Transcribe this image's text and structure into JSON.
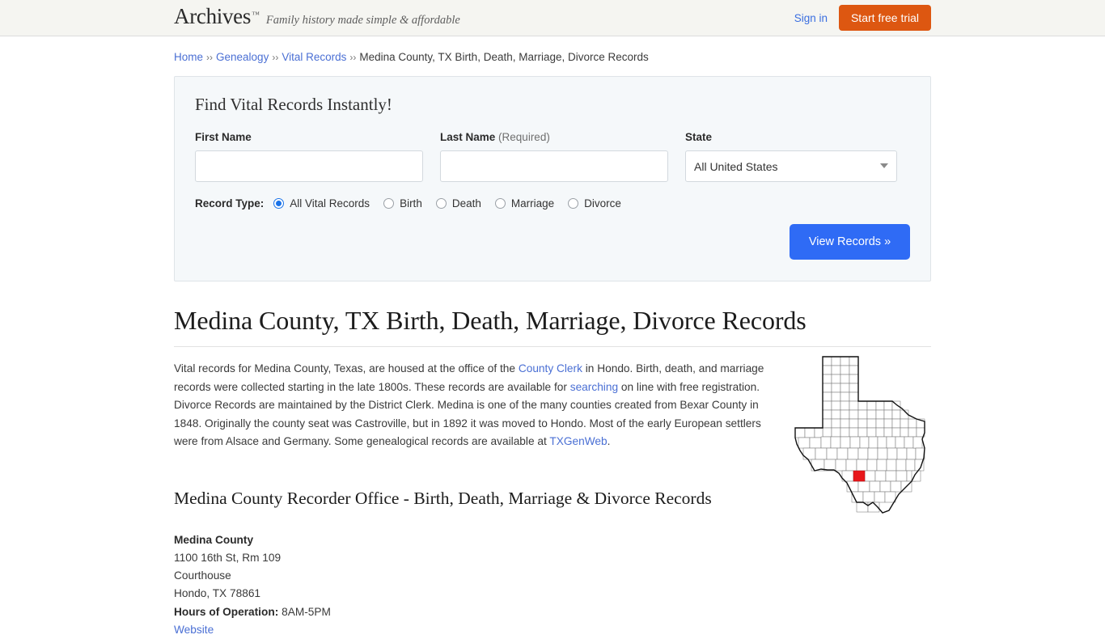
{
  "header": {
    "logo": "Archives",
    "logo_tm": "™",
    "tagline": "Family history made simple & affordable",
    "sign_in": "Sign in",
    "start_trial": "Start free trial",
    "bg_color": "#f5f5f1",
    "trial_color": "#dd5711",
    "link_color": "#3b6fe0"
  },
  "breadcrumb": {
    "separator": "››",
    "items": [
      {
        "label": "Home",
        "is_link": true
      },
      {
        "label": "Genealogy",
        "is_link": true
      },
      {
        "label": "Vital Records",
        "is_link": true
      },
      {
        "label": "Medina County, TX Birth, Death, Marriage, Divorce Records",
        "is_link": false
      }
    ]
  },
  "search_panel": {
    "title": "Find Vital Records Instantly!",
    "first_name": {
      "label": "First Name",
      "value": "",
      "placeholder": ""
    },
    "last_name": {
      "label": "Last Name",
      "required_note": "(Required)",
      "value": "",
      "placeholder": ""
    },
    "state": {
      "label": "State",
      "selected": "All United States"
    },
    "record_type": {
      "label": "Record Type:",
      "options": [
        {
          "label": "All Vital Records",
          "checked": true
        },
        {
          "label": "Birth",
          "checked": false
        },
        {
          "label": "Death",
          "checked": false
        },
        {
          "label": "Marriage",
          "checked": false
        },
        {
          "label": "Divorce",
          "checked": false
        }
      ]
    },
    "submit_label": "View Records »",
    "submit_color": "#2f6bf5",
    "panel_bg": "#f5f8fa"
  },
  "main": {
    "title": "Medina County, TX Birth, Death, Marriage, Divorce Records",
    "paragraph": {
      "part1": "Vital records for Medina County, Texas, are housed at the office of the ",
      "link1": "County Clerk",
      "part2": " in Hondo. Birth, death, and marriage records were collected starting in the late 1800s. These records are available for ",
      "link2": "searching",
      "part3": " on line with free registration. Divorce Records are maintained by the District Clerk. Medina is one of the many counties created from Bexar County in 1848. Originally the county seat was Castroville, but in 1892 it was moved to Hondo. Most of the early European settlers were from Alsace and Germany. Some genealogical records are available at ",
      "link3": "TXGenWeb",
      "part4": "."
    },
    "section_title": "Medina County Recorder Office - Birth, Death, Marriage & Divorce Records",
    "address": {
      "org": "Medina County",
      "street": "1100 16th St, Rm 109",
      "building": "Courthouse",
      "city_state_zip": "Hondo, TX 78861",
      "hours_label": "Hours of Operation:",
      "hours_value": "8AM-5PM",
      "website_label": "Website"
    },
    "map": {
      "state": "Texas",
      "highlight_county": "Medina",
      "highlight_color": "#e8171b"
    }
  }
}
